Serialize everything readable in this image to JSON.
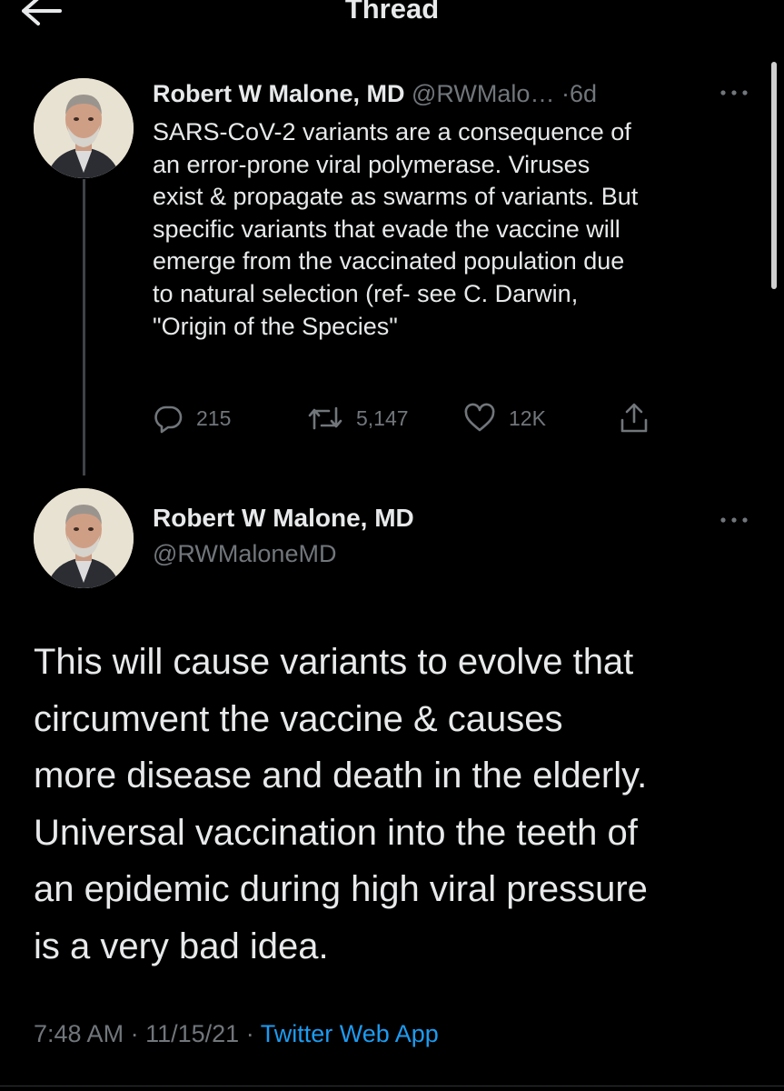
{
  "header": {
    "title": "Thread",
    "back_icon": "arrow-left-icon"
  },
  "tweet1": {
    "name": "Robert W Malone, MD",
    "handle": "@RWMalo…",
    "separator": "·",
    "time": "6d",
    "text": "SARS-CoV-2 variants are a consequence of\nan error-prone viral polymerase. Viruses\nexist & propagate as swarms of variants. But\nspecific variants that evade the vaccine will\nemerge from the vaccinated population due\nto natural selection (ref- see C. Darwin,\n\"Origin of the Species\"",
    "replies": "215",
    "retweets": "5,147",
    "likes": "12K",
    "icons": {
      "reply": "reply-icon",
      "retweet": "retweet-icon",
      "like": "heart-icon",
      "share": "share-icon",
      "more": "more-icon"
    }
  },
  "tweet2": {
    "name": "Robert W Malone, MD",
    "handle": "@RWMaloneMD",
    "text": "This will cause variants to evolve that\ncircumvent the vaccine & causes\nmore disease and death in the elderly.\nUniversal vaccination into the teeth of\nan epidemic during high viral pressure\nis a very bad idea.",
    "time": "7:48 AM",
    "separator1": "·",
    "date": "11/15/21",
    "separator2": "·",
    "source": "Twitter Web App"
  },
  "colors": {
    "background": "#000000",
    "text": "#e7e9ea",
    "secondary": "#71767b",
    "link": "#1d9bf0"
  }
}
